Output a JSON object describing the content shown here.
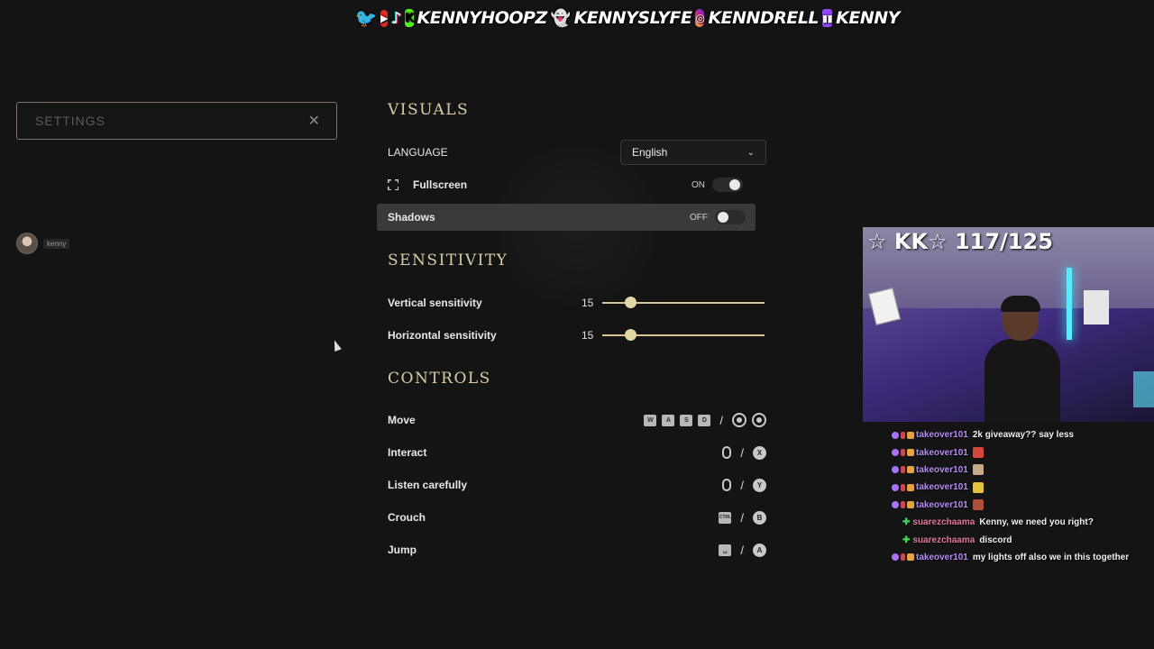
{
  "banner": {
    "handles": [
      "KENNYHOOPZ",
      "KENNYSLYFE",
      "KENNDRELL",
      "KENNY"
    ],
    "icons": [
      "twitter-icon",
      "youtube-icon",
      "tiktok-icon",
      "kick-icon",
      "snapchat-icon",
      "instagram-icon",
      "twitch-icon"
    ]
  },
  "search": {
    "placeholder": "SETTINGS",
    "value": ""
  },
  "user": {
    "name": "kenny"
  },
  "visuals": {
    "title": "VISUALS",
    "language_label": "LANGUAGE",
    "language_value": "English",
    "fullscreen_label": "Fullscreen",
    "fullscreen_state": "ON",
    "shadows_label": "Shadows",
    "shadows_state": "OFF"
  },
  "sensitivity": {
    "title": "SENSITIVITY",
    "vertical_label": "Vertical sensitivity",
    "vertical_value": "15",
    "horizontal_label": "Horizontal sensitivity",
    "horizontal_value": "15",
    "slider_fraction": 0.17
  },
  "controls": {
    "title": "CONTROLS",
    "move_label": "Move",
    "move_keys": [
      "W",
      "A",
      "S",
      "D"
    ],
    "interact_label": "Interact",
    "interact_pad": "X",
    "listen_label": "Listen carefully",
    "listen_pad": "Y",
    "crouch_label": "Crouch",
    "crouch_key": "CTRL",
    "crouch_pad": "B",
    "jump_label": "Jump",
    "jump_key": "␣",
    "jump_pad": "A",
    "separator": "/"
  },
  "stream": {
    "overlay_text": "☆ KK☆ 117/125"
  },
  "chat": [
    {
      "user": "takeover101",
      "text": "2k giveaway?? say less",
      "style": "sub"
    },
    {
      "user": "takeover101",
      "text": "",
      "style": "sub",
      "emote": "#d9443b"
    },
    {
      "user": "takeover101",
      "text": "",
      "style": "sub",
      "emote": "#c7a88a"
    },
    {
      "user": "takeover101",
      "text": "",
      "style": "sub",
      "emote": "#e6c23a"
    },
    {
      "user": "takeover101",
      "text": "",
      "style": "sub",
      "emote": "#b0503a"
    },
    {
      "user": "suarezchaama",
      "text": "Kenny, we need you right?",
      "style": "green"
    },
    {
      "user": "suarezchaama",
      "text": "discord",
      "style": "green"
    },
    {
      "user": "takeover101",
      "text": "my lights off also we in this together",
      "style": "sub"
    }
  ],
  "colors": {
    "accent": "#d9cfa3",
    "background": "#141414",
    "highlight_row": "#3a3a3a",
    "username_purple": "#b58cf2",
    "username_pink": "#e0789d"
  }
}
